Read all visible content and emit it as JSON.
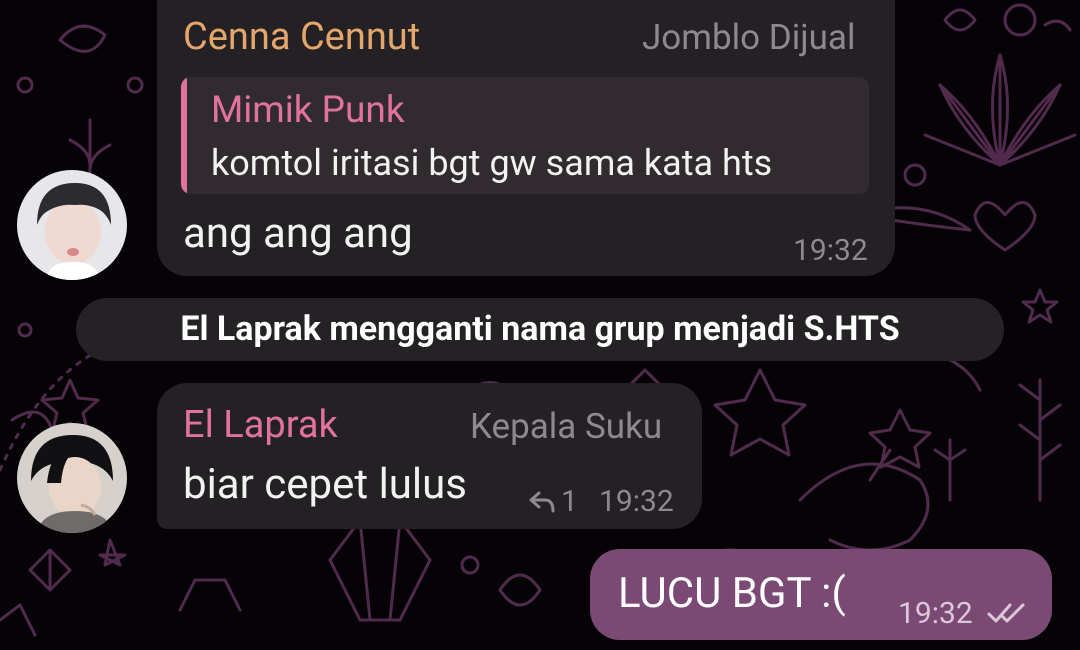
{
  "messages": [
    {
      "sender": "Cenna Cennut",
      "role": "Jomblo Dijual",
      "reply_to": {
        "sender": "Mimik Punk",
        "text": "komtol iritasi bgt gw sama kata hts"
      },
      "text": "ang ang ang",
      "time": "19:32"
    },
    {
      "service": "El Laprak mengganti nama grup menjadi S.HTS"
    },
    {
      "sender": "El Laprak",
      "role": "Kepala Suku",
      "text": "biar cepet lulus",
      "replies_count": "1",
      "time": "19:32"
    },
    {
      "text": "LUCU BGT :(",
      "time": "19:32",
      "status": "read"
    }
  ],
  "colors": {
    "cenna_name": "#e4a66c",
    "mimik_name": "#e0729c",
    "laprak_name": "#e0729c",
    "incoming_bubble": "#232123",
    "outgoing_bubble": "#7a4a75",
    "wallpaper_doodle": "#5a2f55"
  },
  "icons": {
    "reply_count_icon": "reply-arrow-icon",
    "read_status_icon": "double-check-icon"
  }
}
